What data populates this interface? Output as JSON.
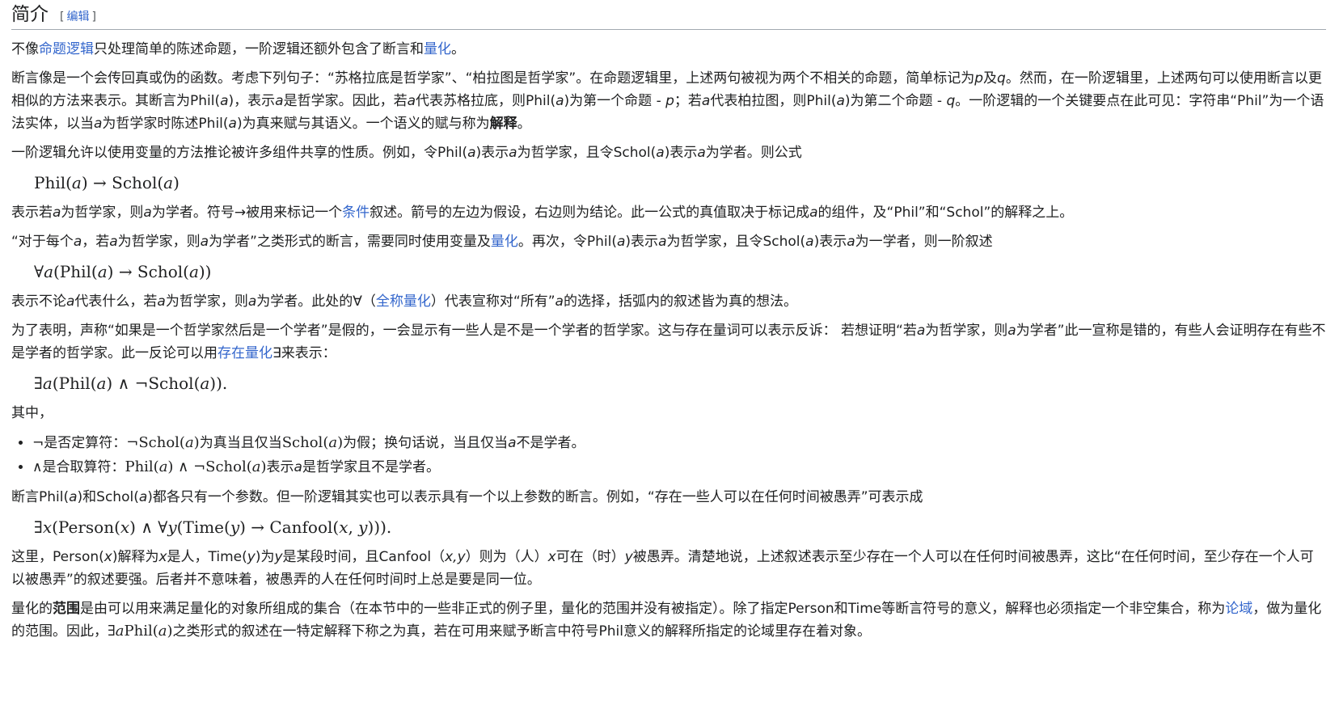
{
  "section": {
    "title": "简介",
    "edit_open": "[",
    "edit_label": "编辑",
    "edit_close": "]"
  },
  "p1": {
    "t1": "不像",
    "link1": "命题逻辑",
    "t2": "只处理简单的陈述命题，一阶逻辑还额外包含了断言和",
    "link2": "量化",
    "t3": "。"
  },
  "p2": {
    "t1": "断言像是一个会传回真或伪的函数。考虑下列句子：“苏格拉底是哲学家”、“柏拉图是哲学家”。在命题逻辑里，上述两句被视为两个不相关的命题，简单标记为",
    "v_p": "p",
    "t2": "及",
    "v_q": "q",
    "t3": "。然而，在一阶逻辑里，上述两句可以使用断言以更相似的方法来表示。其断言为Phil(",
    "v_a1": "a",
    "t4": ")，表示",
    "v_a2": "a",
    "t5": "是哲学家。因此，若",
    "v_a3": "a",
    "t6": "代表苏格拉底，则Phil(",
    "v_a4": "a",
    "t7": ")为第一个命题 - ",
    "v_p2": "p",
    "t8": "；若",
    "v_a5": "a",
    "t9": "代表柏拉图，则Phil(",
    "v_a6": "a",
    "t10": ")为第二个命题 - ",
    "v_q2": "q",
    "t11": "。一阶逻辑的一个关键要点在此可见：字符串“Phil”为一个语法实体，以当",
    "v_a7": "a",
    "t12": "为哲学家时陈述Phil(",
    "v_a8": "a",
    "t13": ")为真来赋与其语义。一个语义的赋与称为",
    "bold": "解释",
    "t14": "。"
  },
  "p3": {
    "t1": "一阶逻辑允许以使用变量的方法推论被许多组件共享的性质。例如，令Phil(",
    "v_a1": "a",
    "t2": ")表示",
    "v_a2": "a",
    "t3": "为哲学家，且令Schol(",
    "v_a3": "a",
    "t4": ")表示",
    "v_a4": "a",
    "t5": "为学者。则公式"
  },
  "f1": "Phil(𝑎) → Schol(𝑎)",
  "p4": {
    "t1": "表示若",
    "v_a1": "a",
    "t2": "为哲学家，则",
    "v_a2": "a",
    "t3": "为学者。符号→被用来标记一个",
    "link1": "条件",
    "t4": "叙述。箭号的左边为假设，右边则为结论。此一公式的真值取决于标记成",
    "v_a3": "a",
    "t5": "的组件，及“Phil”和“Schol”的解释之上。"
  },
  "p5": {
    "t1": "“对于每个",
    "v_a1": "a",
    "t2": "，若",
    "v_a2": "a",
    "t3": "为哲学家，则",
    "v_a3": "a",
    "t4": "为学者”之类形式的断言，需要同时使用变量及",
    "link1": "量化",
    "t5": "。再次，令Phil(",
    "v_a4": "a",
    "t6": ")表示",
    "v_a5": "a",
    "t7": "为哲学家，且令Schol(",
    "v_a6": "a",
    "t8": ")表示",
    "v_a7": "a",
    "t9": "为一学者，则一阶叙述"
  },
  "f2": "∀𝑎(Phil(𝑎) → Schol(𝑎))",
  "p6": {
    "t1": "表示不论",
    "v_a1": "a",
    "t2": "代表什么，若",
    "v_a2": "a",
    "t3": "为哲学家，则",
    "v_a3": "a",
    "t4": "为学者。此处的∀（",
    "link1": "全称量化",
    "t5": "）代表宣称对“所有”",
    "v_a4": "a",
    "t6": "的选择，括弧内的叙述皆为真的想法。"
  },
  "p7": {
    "t1": "为了表明，声称“如果是一个哲学家然后是一个学者”是假的，一会显示有一些人是不是一个学者的哲学家。这与存在量词可以表示反诉： 若想证明“若",
    "v_a1": "a",
    "t2": "为哲学家，则",
    "v_a2": "a",
    "t3": "为学者”此一宣称是错的，有些人会证明存在有些不是学者的哲学家。此一反论可以用",
    "link1": "存在量化",
    "t4": "∃来表示："
  },
  "f3": "∃𝑎(Phil(𝑎) ∧ ¬Schol(𝑎)).",
  "p8": "其中，",
  "bullets": [
    {
      "t1": "¬是否定算符：",
      "m1": "¬Schol(𝑎)",
      "t2": "为真当且仅当",
      "m2": "Schol(𝑎)",
      "t3": "为假；换句话说，当且仅当",
      "v_a": "a",
      "t4": "不是学者。"
    },
    {
      "t1": "∧是合取算符：",
      "m1": "Phil(𝑎) ∧ ¬Schol(𝑎)",
      "t2": "表示",
      "v_a": "a",
      "t3": "是哲学家且不是学者。"
    }
  ],
  "p9": {
    "t1": "断言Phil(",
    "v_a1": "a",
    "t2": ")和Schol(",
    "v_a2": "a",
    "t3": ")都各只有一个参数。但一阶逻辑其实也可以表示具有一个以上参数的断言。例如，“存在一些人可以在任何时间被愚弄”可表示成"
  },
  "f4": "∃𝑥(Person(𝑥) ∧ ∀𝑦(Time(𝑦) → Canfool(𝑥, 𝑦))).",
  "p10": {
    "t1": "这里，Person(",
    "v_x1": "x",
    "t2": ")解释为",
    "v_x2": "x",
    "t3": "是人，Time(",
    "v_y1": "y",
    "t4": ")为",
    "v_y2": "y",
    "t5": "是某段时间，且Canfool（",
    "v_xy": "x,y",
    "t6": "）则为（人）",
    "v_x3": "x",
    "t7": "可在（时）",
    "v_y3": "y",
    "t8": "被愚弄。清楚地说，上述叙述表示至少存在一个人可以在任何时间被愚弄，这比“在任何时间，至少存在一个人可以被愚弄”的叙述要强。后者并不意味着，被愚弄的人在任何时间时上总是要是同一位。"
  },
  "p11": {
    "t1": "量化的",
    "bold": "范围",
    "t2": "是由可以用来满足量化的对象所组成的集合（在本节中的一些非正式的例子里，量化的范围并没有被指定）。除了指定Person和Time等断言符号的意义，解释也必须指定一个非空集合，称为",
    "link1": "论域",
    "t3": "，做为量化的范围。因此，",
    "m1": "∃𝑎Phil(𝑎)",
    "t4": "之类形式的叙述在一特定解释下称之为真，若在可用来赋予断言中符号Phil意义的解释所指定的论域里存在着对象。"
  }
}
